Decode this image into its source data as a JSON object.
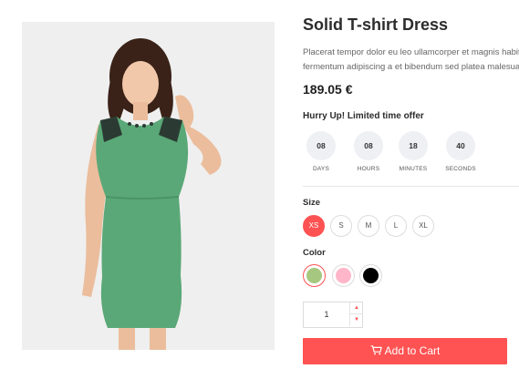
{
  "product": {
    "title": "Solid T-shirt Dress",
    "description_line1": "Placerat tempor dolor eu leo ullamcorper et magnis habit",
    "description_line2": "fermentum adipiscing a et bibendum sed platea malesua",
    "price": "189.05 €",
    "image_icon": "dress-model-photo"
  },
  "offer": {
    "headline": "Hurry Up! Limited time offer",
    "countdown": [
      {
        "value": "08",
        "label": "DAYS"
      },
      {
        "value": "08",
        "label": "HOURS"
      },
      {
        "value": "18",
        "label": "MINUTES"
      },
      {
        "value": "40",
        "label": "SECONDS"
      }
    ]
  },
  "size": {
    "label": "Size",
    "options": [
      "XS",
      "S",
      "M",
      "L",
      "XL"
    ],
    "selected": "XS"
  },
  "color": {
    "label": "Color",
    "options": [
      {
        "name": "green",
        "hex": "#a6c77f"
      },
      {
        "name": "pink",
        "hex": "#ffb6c8"
      },
      {
        "name": "black",
        "hex": "#000000"
      }
    ],
    "selected": "green"
  },
  "quantity": {
    "value": "1",
    "up_icon": "caret-up-icon",
    "down_icon": "caret-down-icon"
  },
  "cart": {
    "label": "Add to Cart",
    "icon": "cart-icon"
  },
  "colors": {
    "accent": "#ff5252",
    "dress": "#5aa877"
  }
}
